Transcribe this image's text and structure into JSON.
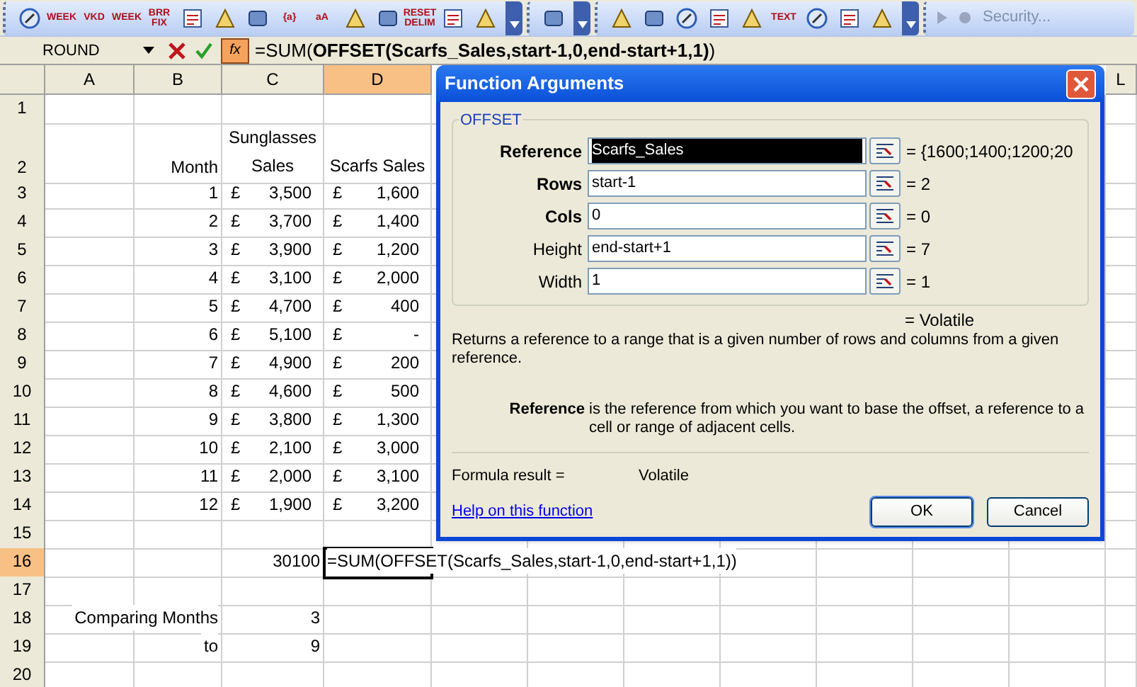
{
  "toolbar": {
    "groups": [
      {
        "items": [
          {
            "kind": "icon"
          },
          {
            "kind": "text",
            "text": "WEEK"
          },
          {
            "kind": "text",
            "text": "VKD"
          },
          {
            "kind": "text",
            "text": "WEEK"
          },
          {
            "kind": "text",
            "text": "BRR FIX"
          },
          {
            "kind": "icon"
          },
          {
            "kind": "icon"
          },
          {
            "kind": "icon"
          },
          {
            "kind": "text",
            "text": "{a}"
          },
          {
            "kind": "text",
            "text": "aA"
          },
          {
            "kind": "icon"
          },
          {
            "kind": "icon"
          },
          {
            "kind": "text",
            "text": "RESET DELIM"
          },
          {
            "kind": "icon"
          },
          {
            "kind": "icon"
          }
        ]
      },
      {
        "items": [
          {
            "kind": "icon"
          }
        ]
      },
      {
        "items": [
          {
            "kind": "icon"
          },
          {
            "kind": "icon"
          },
          {
            "kind": "icon"
          },
          {
            "kind": "icon"
          },
          {
            "kind": "icon"
          },
          {
            "kind": "text",
            "text": "TEXT"
          },
          {
            "kind": "icon"
          },
          {
            "kind": "icon"
          },
          {
            "kind": "icon"
          }
        ]
      }
    ],
    "security": "Security..."
  },
  "formula_bar": {
    "name_box": "ROUND",
    "fx": "fx",
    "formula": "=SUM(**OFFSET(Scarfs_Sales,start-1,0,end-start+1,1)**)"
  },
  "columns": [
    {
      "label": "A",
      "selected": false
    },
    {
      "label": "B",
      "selected": false
    },
    {
      "label": "C",
      "selected": false
    },
    {
      "label": "D",
      "selected": true
    },
    {
      "label": "L",
      "selected": false
    }
  ],
  "rows": [
    {
      "number": "1",
      "selected": false
    },
    {
      "number": "2",
      "selected": false,
      "b": {
        "kind": "label",
        "text": "Month"
      },
      "c": {
        "kind": "heading",
        "text": "Sunglasses Sales"
      },
      "d": {
        "kind": "heading",
        "text": "Scarfs Sales"
      }
    },
    {
      "number": "3",
      "selected": false,
      "b": {
        "kind": "number",
        "text": "1"
      },
      "c": {
        "kind": "currency",
        "symbol": "£",
        "text": "3,500"
      },
      "d": {
        "kind": "currency",
        "symbol": "£",
        "text": "1,600"
      }
    },
    {
      "number": "4",
      "selected": false,
      "b": {
        "kind": "number",
        "text": "2"
      },
      "c": {
        "kind": "currency",
        "symbol": "£",
        "text": "3,700"
      },
      "d": {
        "kind": "currency",
        "symbol": "£",
        "text": "1,400"
      }
    },
    {
      "number": "5",
      "selected": false,
      "b": {
        "kind": "number",
        "text": "3"
      },
      "c": {
        "kind": "currency",
        "symbol": "£",
        "text": "3,900"
      },
      "d": {
        "kind": "currency",
        "symbol": "£",
        "text": "1,200"
      }
    },
    {
      "number": "6",
      "selected": false,
      "b": {
        "kind": "number",
        "text": "4"
      },
      "c": {
        "kind": "currency",
        "symbol": "£",
        "text": "3,100"
      },
      "d": {
        "kind": "currency",
        "symbol": "£",
        "text": "2,000"
      }
    },
    {
      "number": "7",
      "selected": false,
      "b": {
        "kind": "number",
        "text": "5"
      },
      "c": {
        "kind": "currency",
        "symbol": "£",
        "text": "4,700"
      },
      "d": {
        "kind": "currency",
        "symbol": "£",
        "text": "400"
      }
    },
    {
      "number": "8",
      "selected": false,
      "b": {
        "kind": "number",
        "text": "6"
      },
      "c": {
        "kind": "currency",
        "symbol": "£",
        "text": "5,100"
      },
      "d": {
        "kind": "currency",
        "symbol": "£",
        "text": "-"
      }
    },
    {
      "number": "9",
      "selected": false,
      "b": {
        "kind": "number",
        "text": "7"
      },
      "c": {
        "kind": "currency",
        "symbol": "£",
        "text": "4,900"
      },
      "d": {
        "kind": "currency",
        "symbol": "£",
        "text": "200"
      }
    },
    {
      "number": "10",
      "selected": false,
      "b": {
        "kind": "number",
        "text": "8"
      },
      "c": {
        "kind": "currency",
        "symbol": "£",
        "text": "4,600"
      },
      "d": {
        "kind": "currency",
        "symbol": "£",
        "text": "500"
      }
    },
    {
      "number": "11",
      "selected": false,
      "b": {
        "kind": "number",
        "text": "9"
      },
      "c": {
        "kind": "currency",
        "symbol": "£",
        "text": "3,800"
      },
      "d": {
        "kind": "currency",
        "symbol": "£",
        "text": "1,300"
      }
    },
    {
      "number": "12",
      "selected": false,
      "b": {
        "kind": "number",
        "text": "10"
      },
      "c": {
        "kind": "currency",
        "symbol": "£",
        "text": "2,100"
      },
      "d": {
        "kind": "currency",
        "symbol": "£",
        "text": "3,000"
      }
    },
    {
      "number": "13",
      "selected": false,
      "b": {
        "kind": "number",
        "text": "11"
      },
      "c": {
        "kind": "currency",
        "symbol": "£",
        "text": "2,000"
      },
      "d": {
        "kind": "currency",
        "symbol": "£",
        "text": "3,100"
      }
    },
    {
      "number": "14",
      "selected": false,
      "b": {
        "kind": "number",
        "text": "12"
      },
      "c": {
        "kind": "currency",
        "symbol": "£",
        "text": "1,900"
      },
      "d": {
        "kind": "currency",
        "symbol": "£",
        "text": "3,200"
      }
    },
    {
      "number": "15",
      "selected": false
    },
    {
      "number": "16",
      "selected": true,
      "c": {
        "kind": "number",
        "text": "30100"
      },
      "d": {
        "kind": "formula",
        "text": "=SUM(OFFSET(Scarfs_Sales,start-1,0,end-start+1,1))",
        "selected": true
      }
    },
    {
      "number": "17",
      "selected": false
    },
    {
      "number": "18",
      "selected": false,
      "b": {
        "kind": "label",
        "text": "Comparing Months"
      },
      "c": {
        "kind": "number",
        "text": "3"
      }
    },
    {
      "number": "19",
      "selected": false,
      "b": {
        "kind": "label",
        "text": "to"
      },
      "c": {
        "kind": "number",
        "text": "9"
      }
    },
    {
      "number": "20",
      "selected": false
    }
  ],
  "dialog": {
    "title": "Function Arguments",
    "group": "OFFSET",
    "arguments": [
      {
        "label": "Reference",
        "required": true,
        "value": "Scarfs_Sales",
        "selected": true,
        "result": "= {1600;1400;1200;20"
      },
      {
        "label": "Rows",
        "required": true,
        "value": "start-1",
        "selected": false,
        "result": "= 2"
      },
      {
        "label": "Cols",
        "required": true,
        "value": "0",
        "selected": false,
        "result": "= 0"
      },
      {
        "label": "Height",
        "required": false,
        "value": "end-start+1",
        "selected": false,
        "result": "= 7"
      },
      {
        "label": "Width",
        "required": false,
        "value": "1",
        "selected": false,
        "result": "= 1"
      }
    ],
    "function_result": "= Volatile",
    "description": "Returns a reference to a range that is a given number of rows and columns from a given reference.",
    "argument_help": {
      "name": "Reference",
      "text": "is the reference from which you want to base the offset, a reference to a cell or range of adjacent cells."
    },
    "formula_result_label": "Formula result =",
    "formula_result": "Volatile",
    "help_link": "Help on this function",
    "buttons": [
      "OK",
      "Cancel"
    ]
  }
}
